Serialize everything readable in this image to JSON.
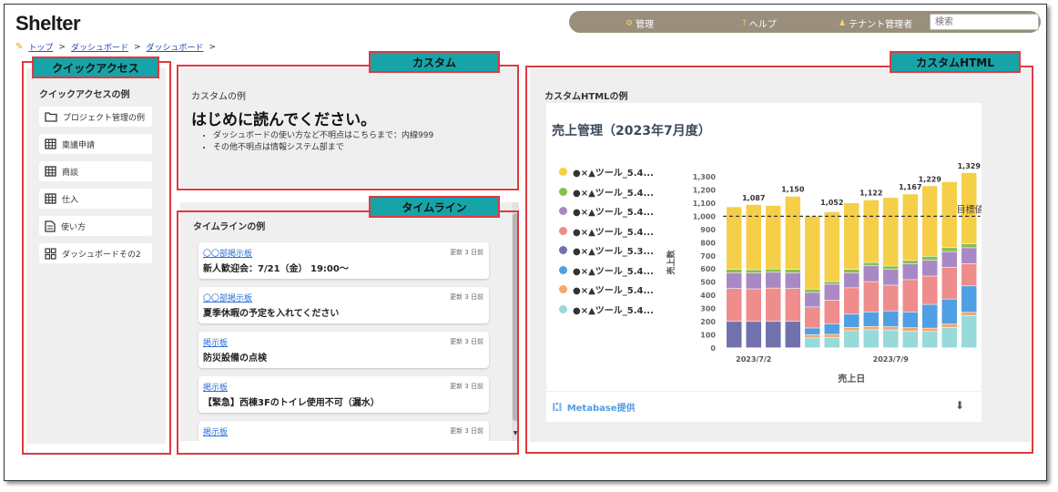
{
  "app": {
    "logo": "Shelter"
  },
  "topnav": {
    "items": [
      {
        "icon": "gear-icon",
        "glyph": "⚙",
        "label": "管理"
      },
      {
        "icon": "help-icon",
        "glyph": "?",
        "label": "ヘルプ"
      },
      {
        "icon": "user-icon",
        "glyph": "♟",
        "label": "テナント管理者"
      }
    ],
    "search_placeholder": "検索"
  },
  "breadcrumb": [
    "トップ",
    "ダッシュボード",
    "ダッシュボード"
  ],
  "tags": {
    "quick": "クイックアクセス",
    "custom": "カスタム",
    "timeline": "タイムライン",
    "html": "カスタムHTML"
  },
  "quick_access": {
    "title": "クイックアクセスの例",
    "items": [
      {
        "icon": "folder-icon",
        "label": "プロジェクト管理の例"
      },
      {
        "icon": "table-icon",
        "label": "稟議申請"
      },
      {
        "icon": "table-icon",
        "label": "商談"
      },
      {
        "icon": "table-icon",
        "label": "仕入"
      },
      {
        "icon": "document-icon",
        "label": "使い方"
      },
      {
        "icon": "dashboard-icon",
        "label": "ダッシュボードその2"
      }
    ]
  },
  "custom": {
    "title": "カスタムの例",
    "heading": "はじめに読んでください。",
    "bullets": [
      "ダッシュボードの使い方など不明点はこちらまで：内線999",
      "その他不明点は情報システム部まで"
    ]
  },
  "timeline": {
    "title": "タイムラインの例",
    "items": [
      {
        "source": "〇〇部掲示板",
        "time": "更新 3 日前",
        "body": "新人歓迎会：7/21（金） 19:00～"
      },
      {
        "source": "〇〇部掲示板",
        "time": "更新 3 日前",
        "body": "夏季休暇の予定を入れてください"
      },
      {
        "source": "掲示板",
        "time": "更新 3 日前",
        "body": "防災設備の点検"
      },
      {
        "source": "掲示板",
        "time": "更新 3 日前",
        "body": "【緊急】西棟3Fのトイレ使用不可（漏水）"
      },
      {
        "source": "掲示板",
        "time": "更新 3 日前",
        "body": ""
      }
    ]
  },
  "custom_html": {
    "title": "カスタムHTMLの例",
    "footer": "Metabase提供"
  },
  "chart_data": {
    "type": "bar",
    "stacked": true,
    "title": "売上管理（2023年7月度）",
    "xlabel": "売上日",
    "ylabel": "売上数",
    "ylim": [
      0,
      1300
    ],
    "yticks": [
      0,
      100,
      200,
      300,
      400,
      500,
      600,
      700,
      800,
      900,
      1000,
      1100,
      1200,
      1300
    ],
    "xtick_labels": [
      {
        "index": 1,
        "label": "2023/7/2"
      },
      {
        "index": 8,
        "label": "2023/7/9"
      }
    ],
    "reference_line": {
      "value": 1000,
      "label": "目標値"
    },
    "totals": [
      1070,
      1087,
      1080,
      1150,
      1000,
      1052,
      1100,
      1122,
      1140,
      1167,
      1229,
      1260,
      1329
    ],
    "total_labels": [
      "",
      "1,087",
      "",
      "1,150",
      "",
      "1,052",
      "",
      "1,122",
      "",
      "1,167",
      "1,229",
      "",
      "1,329"
    ],
    "series": [
      {
        "name": "●×▲ツール_5.4...",
        "color": "#f6cf49",
        "values": [
          475,
          495,
          482,
          555,
          555,
          530,
          505,
          475,
          520,
          505,
          535,
          500,
          540
        ]
      },
      {
        "name": "●×▲ツール_5.4...",
        "color": "#88bf4d",
        "values": [
          25,
          25,
          25,
          25,
          25,
          20,
          25,
          25,
          25,
          25,
          30,
          30,
          30
        ]
      },
      {
        "name": "●×▲ツール_5.4...",
        "color": "#a989c5",
        "values": [
          120,
          120,
          120,
          120,
          110,
          120,
          115,
          120,
          120,
          120,
          120,
          120,
          120
        ]
      },
      {
        "name": "●×▲ツール_5.4...",
        "color": "#ef8c8c",
        "values": [
          250,
          247,
          253,
          250,
          160,
          180,
          200,
          230,
          195,
          245,
          215,
          240,
          170
        ]
      },
      {
        "name": "●×▲ツール_5.3...",
        "color": "#7172ad",
        "values": [
          200,
          200,
          200,
          200,
          0,
          0,
          0,
          0,
          0,
          0,
          0,
          0,
          0
        ]
      },
      {
        "name": "●×▲ツール_5.4...",
        "color": "#509ee3",
        "values": [
          0,
          0,
          0,
          0,
          50,
          80,
          100,
          110,
          120,
          120,
          180,
          190,
          200
        ]
      },
      {
        "name": "●×▲ツール_5.4...",
        "color": "#f2a86f",
        "values": [
          0,
          0,
          0,
          0,
          25,
          25,
          25,
          25,
          25,
          25,
          25,
          25,
          25
        ]
      },
      {
        "name": "●×▲ツール_5.4...",
        "color": "#98d9d9",
        "values": [
          0,
          0,
          0,
          0,
          75,
          77,
          130,
          137,
          135,
          127,
          124,
          155,
          244
        ]
      }
    ]
  }
}
